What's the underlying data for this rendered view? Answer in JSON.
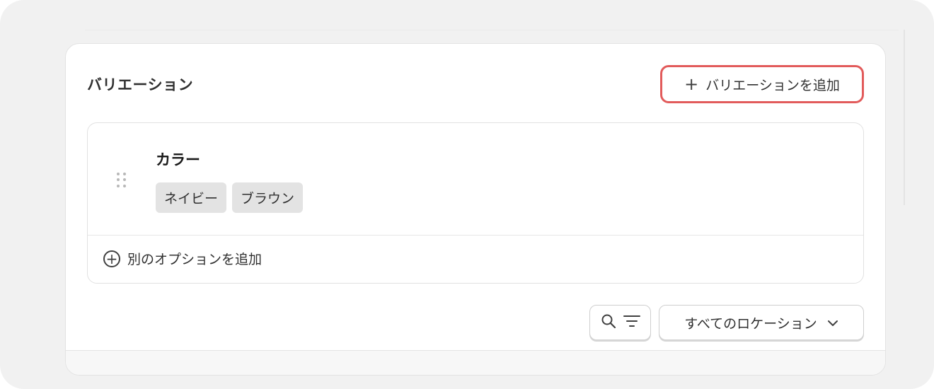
{
  "card": {
    "title": "バリエーション"
  },
  "actions": {
    "add_variation_label": "バリエーションを追加"
  },
  "option": {
    "name": "カラー",
    "values": [
      "ネイビー",
      "ブラウン"
    ],
    "add_option_label": "別のオプションを追加"
  },
  "toolbar": {
    "location_select_value": "すべてのロケーション"
  },
  "icons": {
    "add": "plus-icon",
    "drag": "drag-handle-icon",
    "add_option": "circle-plus-icon",
    "search": "search-icon",
    "filter": "filter-icon",
    "dropdown": "chevron-down-icon"
  },
  "colors": {
    "highlight_border": "#e25b5b"
  }
}
